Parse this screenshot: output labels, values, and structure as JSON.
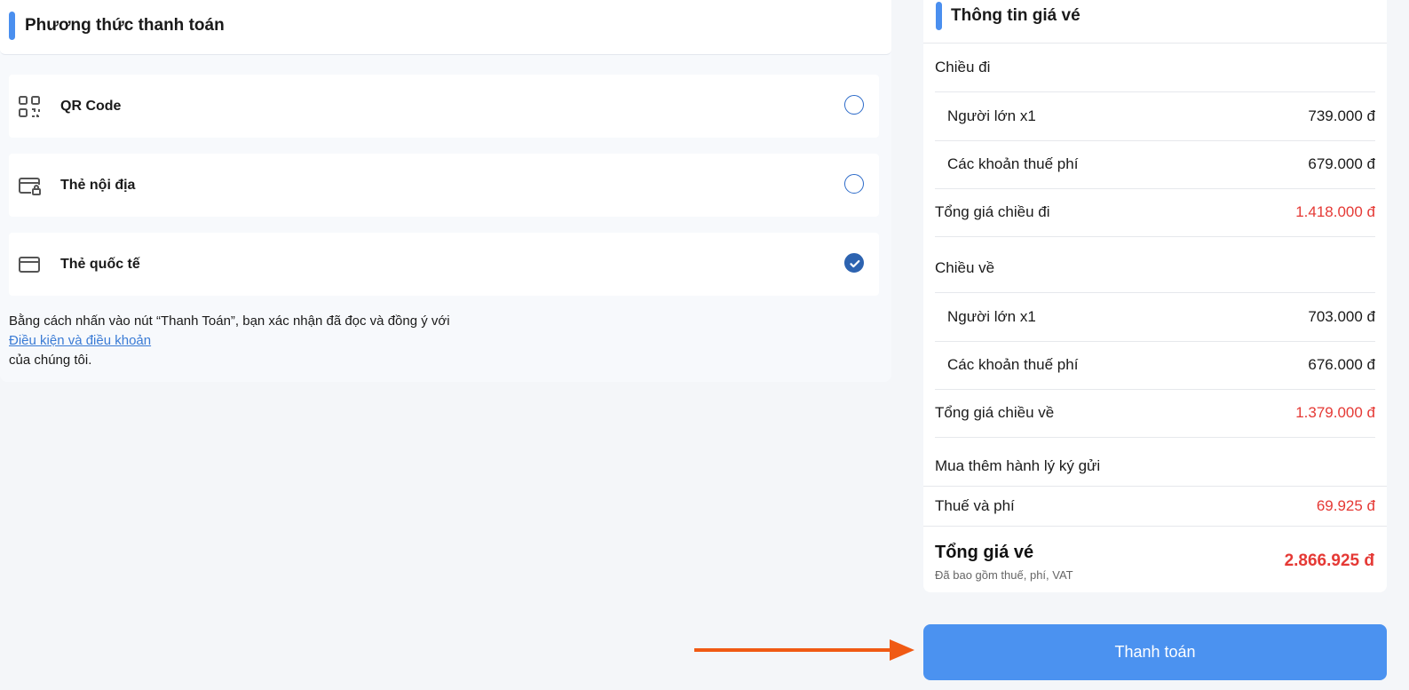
{
  "payment": {
    "title": "Phương thức thanh toán",
    "methods": [
      {
        "label": "QR Code",
        "icon": "qr-code-icon",
        "selected": false
      },
      {
        "label": "Thẻ nội địa",
        "icon": "domestic-card-icon",
        "selected": false
      },
      {
        "label": "Thẻ quốc tế",
        "icon": "credit-card-icon",
        "selected": true
      }
    ],
    "terms_prefix": "Bằng cách nhấn vào nút “Thanh Toán”, bạn xác nhận đã đọc và đồng ý với",
    "terms_link": "Điều kiện và điều khoản",
    "terms_suffix": "của chúng tôi."
  },
  "fare": {
    "title": "Thông tin giá vé",
    "outbound": {
      "heading": "Chiều đi",
      "adult_label": "Người lớn x1",
      "adult_value": "739.000 đ",
      "tax_label": "Các khoản thuế phí",
      "tax_value": "679.000 đ",
      "total_label": "Tổng giá chiều đi",
      "total_value": "1.418.000 đ"
    },
    "return": {
      "heading": "Chiều về",
      "adult_label": "Người lớn x1",
      "adult_value": "703.000 đ",
      "tax_label": "Các khoản thuế phí",
      "tax_value": "676.000 đ",
      "total_label": "Tổng giá chiều về",
      "total_value": "1.379.000 đ"
    },
    "baggage_label": "Mua thêm hành lý ký gửi",
    "fees_label": "Thuế và phí",
    "fees_value": "69.925 đ",
    "grand_total_label": "Tổng giá vé",
    "grand_total_note": "Đã bao gồm thuế, phí, VAT",
    "grand_total_value": "2.866.925 đ"
  },
  "pay_button": "Thanh toán",
  "colors": {
    "accent": "#4a8fef",
    "price_red": "#e53935",
    "button": "#4b92f0",
    "arrow": "#f05a14"
  }
}
